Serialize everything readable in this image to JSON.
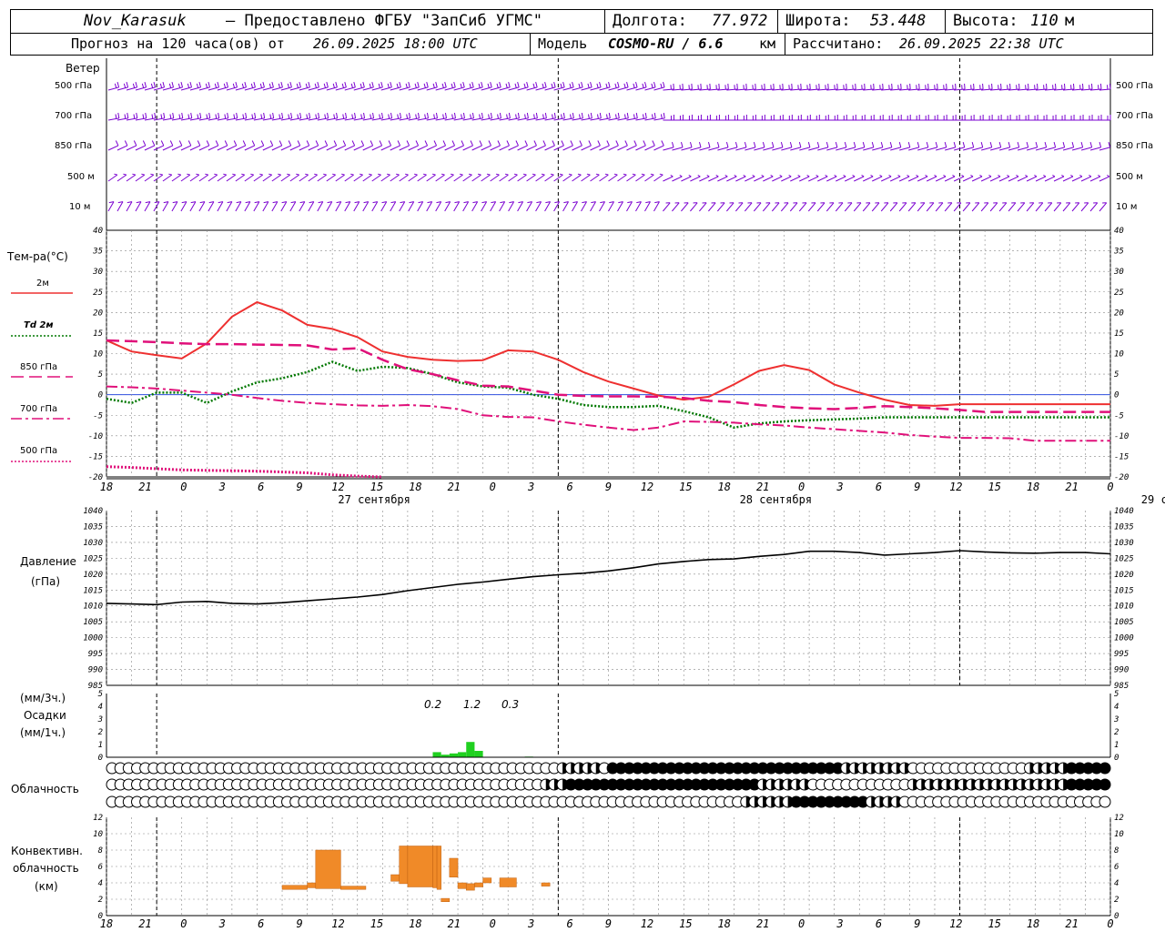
{
  "header": {
    "station": "Nov_Karasuk",
    "provided": "– Предоставлено ФГБУ \"ЗапСиб УГМС\"",
    "lon_label": "Долгота:",
    "lon": "77.972",
    "lat_label": "Широта:",
    "lat": "53.448",
    "alt_label": "Высота:",
    "alt": "110",
    "alt_unit": "м",
    "forecast_prefix": "Прогноз на 120 часа(ов) от",
    "forecast_from": "26.09.2025 18:00 UTC",
    "model_label": "Модель",
    "model": "COSMO-RU / 6.6",
    "model_unit": "км",
    "calc_label": "Рассчитано:",
    "calc": "26.09.2025 22:38 UTC"
  },
  "time_axis": {
    "hour_labels": [
      "18",
      "21",
      "0",
      "3",
      "6",
      "9",
      "12",
      "15",
      "18",
      "21",
      "0",
      "3",
      "6",
      "9",
      "12",
      "15",
      "18",
      "21",
      "0",
      "3",
      "6",
      "9",
      "12",
      "15",
      "18",
      "21",
      "0"
    ],
    "day_labels": [
      "27 сентября",
      "28 сентября",
      "29 сентября"
    ]
  },
  "wind_panel": {
    "title": "Ветер",
    "levels": [
      "500 гПа",
      "700 гПа",
      "850 гПа",
      "500 м",
      "10 м"
    ],
    "color": "#7a00d0"
  },
  "temp_panel": {
    "title": "Тем-ра(°С)",
    "legend": [
      {
        "label": "2м",
        "color": "#ee3030",
        "style": "solid"
      },
      {
        "label": "Td  2м",
        "color": "#007800",
        "style": "dotted"
      },
      {
        "label": "850 гПа",
        "color": "#e0107a",
        "style": "dashed"
      },
      {
        "label": "700 гПа",
        "color": "#e0107a",
        "style": "dashdot"
      },
      {
        "label": "500 гПа",
        "color": "#e0107a",
        "style": "dotted"
      }
    ],
    "yticks": [
      "40",
      "35",
      "30",
      "25",
      "20",
      "15",
      "10",
      "5",
      "0",
      "-5",
      "-10",
      "-15",
      "-20"
    ]
  },
  "pressure_panel": {
    "title": "Давление",
    "unit": "(гПа)",
    "yticks": [
      "1040",
      "1035",
      "1030",
      "1025",
      "1020",
      "1015",
      "1010",
      "1005",
      "1000",
      "995",
      "990",
      "985"
    ]
  },
  "precip_panel": {
    "unit3": "(мм/3ч.)",
    "title": "Осадки",
    "unit1": "(мм/1ч.)",
    "yticks": [
      "5",
      "4",
      "3",
      "2",
      "1",
      "0"
    ],
    "amounts": [
      "0.2",
      "1.2",
      "0.3"
    ],
    "color": "#20d020"
  },
  "cloud_panel": {
    "title": "Облачность"
  },
  "conv_panel": {
    "title1": "Конвективн.",
    "title2": "облачность",
    "unit": "(км)",
    "yticks": [
      "12",
      "10",
      "8",
      "6",
      "4",
      "2",
      "0"
    ],
    "color": "#f08a28"
  },
  "chart_data": [
    {
      "type": "line",
      "title": "Тем-ра(°С)",
      "x_hours_from_start": [
        0,
        3,
        6,
        9,
        12,
        15,
        18,
        21,
        24,
        27,
        30,
        33,
        36,
        39,
        42,
        45,
        48,
        51,
        54,
        57,
        60,
        63,
        66,
        69,
        72,
        75,
        78,
        81,
        84,
        87,
        90,
        93,
        96,
        99,
        102,
        105,
        108,
        111,
        114,
        117,
        120
      ],
      "ylim": [
        -20,
        40
      ],
      "series": [
        {
          "name": "2м",
          "values": [
            13.2,
            10.5,
            9.6,
            8.8,
            12.5,
            19.0,
            22.5,
            20.5,
            17.0,
            16.0,
            14.0,
            10.5,
            9.2,
            8.5,
            8.2,
            8.4,
            10.8,
            10.5,
            8.5,
            5.5,
            3.2,
            1.5,
            -0.2,
            -1.2,
            -0.5,
            2.5,
            5.8,
            7.2,
            6.0,
            2.5,
            0.5,
            -1.2,
            -2.5,
            -2.7,
            -2.3,
            -2.3,
            -2.3,
            -2.3,
            -2.3,
            -2.3,
            -2.3
          ]
        },
        {
          "name": "Td  2м",
          "values": [
            -1.0,
            -2.0,
            0.5,
            0.5,
            -2.0,
            0.8,
            3.0,
            4.0,
            5.5,
            8.0,
            5.8,
            6.8,
            6.5,
            5.0,
            3.0,
            2.0,
            1.7,
            0.0,
            -1.0,
            -2.5,
            -3.0,
            -3.0,
            -2.7,
            -4.0,
            -5.5,
            -8.0,
            -7.0,
            -6.5,
            -6.2,
            -6.0,
            -5.8,
            -5.5,
            -5.5,
            -5.5,
            -5.5,
            -5.5,
            -5.5,
            -5.5,
            -5.5,
            -5.5,
            -5.5
          ]
        },
        {
          "name": "850 гПа",
          "values": [
            13.2,
            13.0,
            12.8,
            12.5,
            12.3,
            12.3,
            12.2,
            12.1,
            12.0,
            11.0,
            11.3,
            8.5,
            6.2,
            5.0,
            3.5,
            2.2,
            2.0,
            1.0,
            0.0,
            -0.3,
            -0.4,
            -0.4,
            -0.5,
            -0.8,
            -1.5,
            -1.8,
            -2.5,
            -3.0,
            -3.3,
            -3.5,
            -3.2,
            -2.8,
            -3.0,
            -3.3,
            -3.7,
            -4.2,
            -4.2,
            -4.2,
            -4.2,
            -4.2,
            -4.2
          ]
        },
        {
          "name": "700 гПа",
          "values": [
            2.0,
            1.8,
            1.5,
            1.0,
            0.5,
            0.0,
            -0.8,
            -1.5,
            -2.0,
            -2.3,
            -2.6,
            -2.7,
            -2.5,
            -2.8,
            -3.5,
            -5.0,
            -5.4,
            -5.5,
            -6.5,
            -7.3,
            -8.0,
            -8.6,
            -8.0,
            -6.5,
            -6.6,
            -6.8,
            -7.2,
            -7.5,
            -8.0,
            -8.4,
            -8.8,
            -9.2,
            -9.8,
            -10.2,
            -10.5,
            -10.5,
            -10.6,
            -11.2,
            -11.2,
            -11.2,
            -11.2
          ]
        },
        {
          "name": "500 гПа",
          "values": [
            -17.5,
            -17.7,
            -18.0,
            -18.3,
            -18.4,
            -18.5,
            -18.6,
            -18.8,
            -19.0,
            -19.5,
            -19.8,
            -20.0
          ]
        }
      ]
    },
    {
      "type": "line",
      "title": "Давление",
      "x_hours_from_start": [
        0,
        3,
        6,
        9,
        12,
        15,
        18,
        21,
        24,
        27,
        30,
        33,
        36,
        39,
        42,
        45,
        48,
        51,
        54,
        57,
        60,
        63,
        66,
        69,
        72,
        75,
        78,
        81,
        84,
        87,
        90,
        93,
        96,
        99,
        102,
        105,
        108,
        111,
        114,
        117,
        120
      ],
      "ylim": [
        985,
        1040
      ],
      "series": [
        {
          "name": "Давление",
          "values": [
            1010.8,
            1010.6,
            1010.4,
            1011.2,
            1011.4,
            1010.8,
            1010.6,
            1011.0,
            1011.6,
            1012.2,
            1012.8,
            1013.6,
            1014.8,
            1015.8,
            1016.8,
            1017.5,
            1018.4,
            1019.2,
            1019.8,
            1020.3,
            1021.0,
            1022.0,
            1023.2,
            1024.0,
            1024.6,
            1024.8,
            1025.6,
            1026.2,
            1027.2,
            1027.2,
            1026.8,
            1026.0,
            1026.4,
            1026.8,
            1027.4,
            1027.0,
            1026.7,
            1026.6,
            1026.8,
            1026.8,
            1026.4
          ]
        }
      ]
    },
    {
      "type": "bar",
      "title": "Осадки",
      "x_hours_from_start": [
        39,
        40,
        41,
        42,
        43,
        44,
        45,
        50
      ],
      "values": [
        0.4,
        0.2,
        0.3,
        0.4,
        1.2,
        0.5,
        0.0,
        0.05
      ],
      "ylim": [
        0,
        5
      ]
    },
    {
      "type": "bar",
      "title": "Конвективн. облачность",
      "ylim": [
        0,
        12
      ],
      "bars": [
        {
          "start": 21,
          "end": 24,
          "low": 3.2,
          "high": 3.7
        },
        {
          "start": 24,
          "end": 25,
          "low": 3.4,
          "high": 4.0
        },
        {
          "start": 25,
          "end": 28,
          "low": 3.3,
          "high": 8.0
        },
        {
          "start": 28,
          "end": 31,
          "low": 3.2,
          "high": 3.6
        },
        {
          "start": 34,
          "end": 35,
          "low": 4.2,
          "high": 5.0
        },
        {
          "start": 35,
          "end": 36,
          "low": 3.9,
          "high": 8.5
        },
        {
          "start": 36,
          "end": 39,
          "low": 3.5,
          "high": 8.5
        },
        {
          "start": 39,
          "end": 39.5,
          "low": 3.4,
          "high": 8.5
        },
        {
          "start": 39.5,
          "end": 40,
          "low": 3.2,
          "high": 8.5
        },
        {
          "start": 40,
          "end": 41,
          "low": 1.7,
          "high": 2.1
        },
        {
          "start": 41,
          "end": 42,
          "low": 4.7,
          "high": 7.0
        },
        {
          "start": 42,
          "end": 43,
          "low": 3.3,
          "high": 4.0
        },
        {
          "start": 43,
          "end": 44,
          "low": 3.1,
          "high": 3.9
        },
        {
          "start": 44,
          "end": 45,
          "low": 3.5,
          "high": 4.0
        },
        {
          "start": 45,
          "end": 46,
          "low": 4.0,
          "high": 4.6
        },
        {
          "start": 47,
          "end": 49,
          "low": 3.5,
          "high": 4.6
        },
        {
          "start": 52,
          "end": 53,
          "low": 3.6,
          "high": 4.0
        }
      ]
    },
    {
      "type": "table",
      "title": "Облачность",
      "rows": [
        {
          "values": [
            0,
            0,
            0,
            0,
            0,
            0,
            0,
            0,
            0,
            0,
            0,
            0,
            0,
            0,
            0,
            0,
            0,
            0,
            0,
            0,
            0,
            0,
            0,
            0,
            0,
            0,
            0,
            0,
            0,
            0,
            0,
            0,
            0,
            0,
            0,
            0,
            0,
            0,
            0,
            0,
            0,
            0,
            0,
            0,
            0,
            0,
            0,
            0,
            0,
            0,
            0,
            0,
            0,
            0,
            0,
            0,
            0,
            0,
            0,
            0,
            0,
            0,
            0,
            0,
            0,
            0,
            0,
            0,
            0,
            0,
            0,
            0,
            0,
            0,
            0,
            0,
            0,
            0,
            0,
            0,
            0,
            0,
            0,
            0,
            0,
            0,
            0,
            0,
            0,
            0,
            0,
            0,
            0,
            0,
            0,
            0,
            0,
            0,
            0,
            0,
            0,
            0,
            0,
            0,
            0,
            0,
            0,
            0,
            0,
            0,
            0,
            0,
            0,
            0,
            0,
            0,
            0,
            0,
            0,
            0
          ]
        },
        {
          "values": [
            0,
            0,
            0,
            0,
            0,
            0,
            0,
            0,
            0,
            0,
            0,
            0,
            0,
            0,
            0,
            0,
            0,
            0,
            0,
            0,
            0,
            0,
            0,
            0,
            0,
            0,
            0,
            0,
            0,
            0,
            0,
            0,
            0,
            0,
            0,
            0,
            0,
            0,
            0,
            0,
            0,
            0,
            0,
            0,
            0,
            0,
            0,
            0,
            0,
            0,
            0,
            0,
            0,
            0,
            0,
            0,
            0,
            0,
            0,
            0,
            0,
            0,
            0,
            0,
            0,
            0,
            0,
            0,
            0,
            0,
            0,
            0,
            0,
            0,
            0,
            0,
            0,
            0,
            0,
            0,
            0,
            0,
            0,
            0,
            0,
            0,
            0,
            0,
            0,
            0,
            0,
            0,
            0,
            0,
            0,
            0,
            0,
            0,
            0,
            0,
            0,
            0,
            0,
            0,
            0,
            0,
            0,
            0,
            0,
            0,
            0,
            0,
            0,
            0,
            0,
            0,
            0,
            0,
            0,
            0
          ]
        },
        {
          "values": [
            0,
            0,
            0,
            0,
            0,
            0,
            0,
            0,
            0,
            0,
            0,
            0,
            0,
            0,
            0,
            0,
            0,
            0,
            0,
            0,
            0,
            0,
            0,
            0,
            0,
            0,
            0,
            0,
            0,
            0,
            0,
            0,
            0,
            0,
            0,
            0,
            0,
            0,
            0,
            0,
            0,
            0,
            0,
            0,
            0,
            0,
            0,
            0,
            0,
            0,
            0,
            0,
            0,
            0,
            0,
            0,
            0,
            0,
            0,
            0,
            0,
            0,
            0,
            0,
            0,
            0,
            0,
            0,
            0,
            0,
            0,
            0,
            0,
            0,
            0,
            0,
            0,
            0,
            0,
            0,
            0,
            0,
            0,
            0,
            0,
            0,
            0,
            0,
            0,
            0,
            0,
            0,
            0,
            0,
            0,
            0,
            0,
            0,
            0,
            0,
            0,
            0,
            0,
            0,
            0,
            0,
            0,
            0,
            0,
            0,
            0,
            0,
            0,
            0,
            0,
            0,
            0,
            0,
            0,
            0
          ]
        }
      ]
    }
  ]
}
